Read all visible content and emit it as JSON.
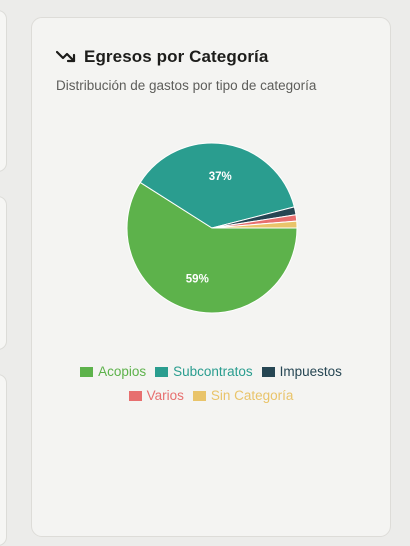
{
  "card": {
    "title": "Egresos por Categoría",
    "subtitle": "Distribución de gastos por tipo de categoría",
    "icon": "trending-down-icon"
  },
  "chart_data": {
    "type": "pie",
    "categories": [
      "Acopios",
      "Subcontratos",
      "Impuestos",
      "Varios",
      "Sin Categoría"
    ],
    "values": [
      59,
      37,
      1.5,
      1.2,
      1.3
    ],
    "data_labels": [
      "59%",
      "37%",
      "",
      "",
      ""
    ],
    "colors": [
      "#5db24b",
      "#2a9d8f",
      "#264653",
      "#e76f6f",
      "#e9c46a"
    ],
    "legend_position": "bottom"
  }
}
